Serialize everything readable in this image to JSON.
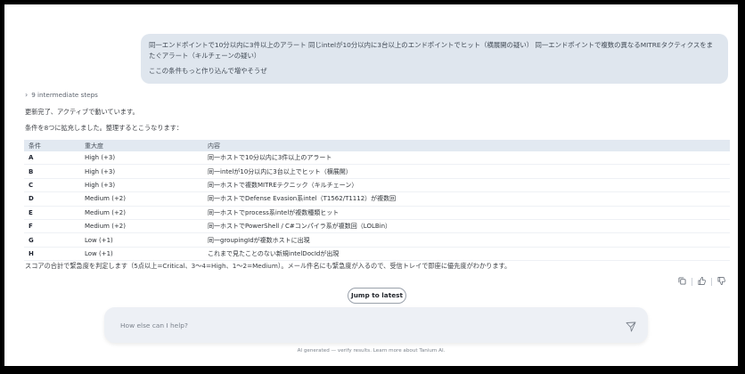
{
  "user_message": {
    "line1": "同一エンドポイントで10分以内に3件以上のアラート 同じintelが10分以内に3台以上のエンドポイントでヒット（横展開の疑い） 同一エンドポイントで複数の異なるMITREタクティクスをまたぐアラート（キルチェーンの疑い）",
    "line2": "ここの条件もっと作り込んで増やそうぜ"
  },
  "steps_label": "9 intermediate steps",
  "response": {
    "line1": "更新完了、アクティブで動いています。",
    "line2": "条件を8つに拡充しました。整理するとこうなります：",
    "summary": "スコアの合計で緊急度を判定します（5点以上=Critical、3〜4=High、1〜2=Medium）。メール件名にも緊急度が入るので、受信トレイで即座に優先度がわかります。"
  },
  "table": {
    "headers": [
      "条件",
      "重大度",
      "内容"
    ],
    "rows": [
      [
        "A",
        "High (+3)",
        "同一ホストで10分以内に3件以上のアラート"
      ],
      [
        "B",
        "High (+3)",
        "同一intelが10分以内に3台以上でヒット（横展開）"
      ],
      [
        "C",
        "High (+3)",
        "同一ホストで複数MITREテクニック（キルチェーン）"
      ],
      [
        "D",
        "Medium (+2)",
        "同一ホストでDefense Evasion系intel（T1562/T1112）が複数回"
      ],
      [
        "E",
        "Medium (+2)",
        "同一ホストでprocess系intelが複数種類ヒット"
      ],
      [
        "F",
        "Medium (+2)",
        "同一ホストでPowerShell / C#コンパイラ系が複数回（LOLBin）"
      ],
      [
        "G",
        "Low (+1)",
        "同一groupingIdが複数ホストに出現"
      ],
      [
        "H",
        "Low (+1)",
        "これまで見たことのない新規intelDocIdが出現"
      ]
    ]
  },
  "jump_button": "Jump to latest",
  "input": {
    "placeholder": "How else can I help?"
  },
  "footer": "AI generated — verify results. Learn more about Tanium AI.",
  "icons": [
    "chevron-right-icon",
    "copy-icon",
    "thumbs-up-icon",
    "thumbs-down-icon",
    "send-icon"
  ]
}
